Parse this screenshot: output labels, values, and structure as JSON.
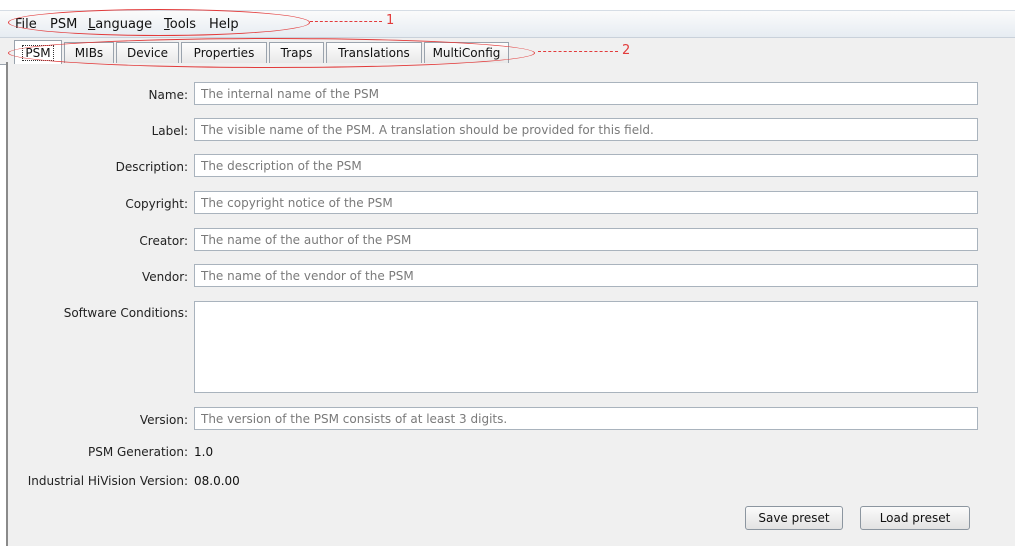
{
  "menubar": {
    "items": [
      {
        "label": "File",
        "mnemonic": ""
      },
      {
        "label": "PSM",
        "mnemonic": ""
      },
      {
        "label": "Language",
        "mnemonic": "L"
      },
      {
        "label": "Tools",
        "mnemonic": "T"
      },
      {
        "label": "Help",
        "mnemonic": ""
      }
    ]
  },
  "tabs": [
    {
      "label": "PSM",
      "active": true
    },
    {
      "label": "MIBs"
    },
    {
      "label": "Device"
    },
    {
      "label": "Properties"
    },
    {
      "label": "Traps"
    },
    {
      "label": "Translations"
    },
    {
      "label": "MultiConfig"
    }
  ],
  "form": {
    "name": {
      "label": "Name:",
      "placeholder": "The internal name of the PSM"
    },
    "label": {
      "label": "Label:",
      "placeholder": "The visible name of the PSM. A translation should be provided for this field."
    },
    "description": {
      "label": "Description:",
      "placeholder": "The description of the PSM"
    },
    "copyright": {
      "label": "Copyright:",
      "placeholder": "The copyright notice of the PSM"
    },
    "creator": {
      "label": "Creator:",
      "placeholder": "The name of the author of the PSM"
    },
    "vendor": {
      "label": "Vendor:",
      "placeholder": "The name of the vendor of the PSM"
    },
    "software_conditions": {
      "label": "Software Conditions:",
      "value": ""
    },
    "version": {
      "label": "Version:",
      "placeholder": "The version of the PSM consists of at least 3 digits."
    },
    "psm_generation": {
      "label": "PSM Generation:",
      "value": "1.0"
    },
    "hivision_version": {
      "label": "Industrial HiVision Version:",
      "value": "08.0.00"
    }
  },
  "buttons": {
    "save_preset": "Save preset",
    "load_preset": "Load preset"
  },
  "annotations": {
    "one": "1",
    "two": "2",
    "color": "#e23b3b"
  }
}
